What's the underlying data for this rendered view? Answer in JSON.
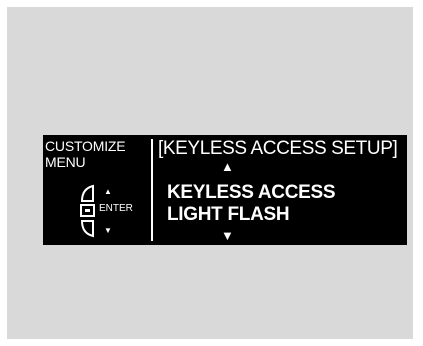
{
  "menu": {
    "title": "CUSTOMIZE\nMENU",
    "enter_label": "ENTER",
    "up_symbol": "▲",
    "down_symbol": "▼"
  },
  "setup": {
    "title": "[KEYLESS ACCESS SETUP]",
    "up_symbol": "▲",
    "down_symbol": "▼",
    "option_lines": [
      "KEYLESS ACCESS",
      "LIGHT FLASH"
    ]
  }
}
